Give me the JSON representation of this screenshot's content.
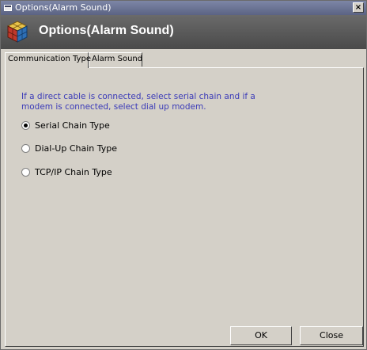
{
  "window": {
    "title": "Options(Alarm Sound)",
    "close_glyph": "×"
  },
  "banner": {
    "title": "Options(Alarm Sound)",
    "icon": "app-cube-icon"
  },
  "tabs": [
    {
      "label": "Communication Type",
      "active": true
    },
    {
      "label": "Alarm Sound",
      "active": false
    }
  ],
  "panel": {
    "info_text": "If a direct cable is connected, select serial chain and if a modem is connected, select dial up modem.",
    "options": [
      {
        "label": "Serial Chain Type",
        "checked": true
      },
      {
        "label": "Dial-Up Chain Type",
        "checked": false
      },
      {
        "label": "TCP/IP Chain Type",
        "checked": false
      }
    ]
  },
  "buttons": {
    "ok": "OK",
    "close": "Close"
  },
  "colors": {
    "info_text": "#3a3ab8",
    "title_bar": "#5b6384",
    "banner": "#4a4a4a",
    "dialog": "#d4d0c8"
  }
}
